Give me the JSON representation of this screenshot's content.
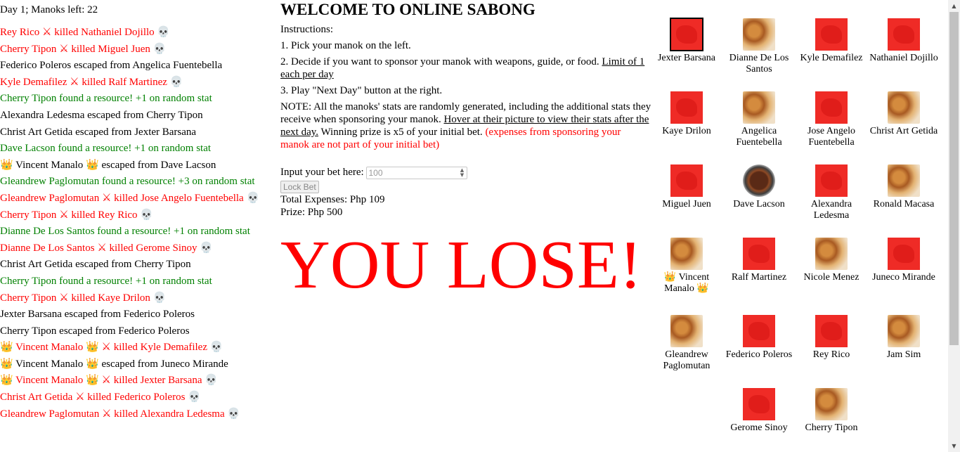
{
  "status": "Day 1; Manoks left: 22",
  "log": [
    {
      "type": "kill",
      "pre": "",
      "a": "Rey Rico",
      "a_suffix": "",
      "mid": " ⚔ killed ",
      "b": "Nathaniel Dojillo",
      "end": " 💀"
    },
    {
      "type": "kill",
      "pre": "",
      "a": "Cherry Tipon",
      "a_suffix": "",
      "mid": " ⚔ killed ",
      "b": "Miguel Juen",
      "end": " 💀"
    },
    {
      "type": "esc",
      "text": "Federico Poleros escaped from Angelica Fuentebella"
    },
    {
      "type": "kill",
      "pre": "",
      "a": "Kyle Demafilez",
      "a_suffix": "",
      "mid": " ⚔ killed ",
      "b": "Ralf Martinez",
      "end": " 💀"
    },
    {
      "type": "res",
      "text": "Cherry Tipon found a resource! +1 on random stat"
    },
    {
      "type": "esc",
      "text": "Alexandra Ledesma escaped from Cherry Tipon"
    },
    {
      "type": "esc",
      "text": "Christ Art Getida escaped from Jexter Barsana"
    },
    {
      "type": "res",
      "text": "Dave Lacson found a resource! +1 on random stat"
    },
    {
      "type": "esc",
      "text": "👑 Vincent Manalo 👑 escaped from Dave Lacson"
    },
    {
      "type": "res",
      "text": "Gleandrew Paglomutan found a resource! +3 on random stat"
    },
    {
      "type": "kill",
      "pre": "",
      "a": "Gleandrew Paglomutan",
      "a_suffix": "",
      "mid": " ⚔ killed ",
      "b": "Jose Angelo Fuentebella",
      "end": " 💀"
    },
    {
      "type": "kill",
      "pre": "",
      "a": "Cherry Tipon",
      "a_suffix": "",
      "mid": " ⚔ killed ",
      "b": "Rey Rico",
      "end": " 💀"
    },
    {
      "type": "res",
      "text": "Dianne De Los Santos found a resource! +1 on random stat"
    },
    {
      "type": "kill",
      "pre": "",
      "a": "Dianne De Los Santos",
      "a_suffix": "",
      "mid": " ⚔ killed ",
      "b": "Gerome Sinoy",
      "end": " 💀"
    },
    {
      "type": "esc",
      "text": "Christ Art Getida escaped from Cherry Tipon"
    },
    {
      "type": "res",
      "text": "Cherry Tipon found a resource! +1 on random stat"
    },
    {
      "type": "kill",
      "pre": "",
      "a": "Cherry Tipon",
      "a_suffix": "",
      "mid": " ⚔ killed ",
      "b": "Kaye Drilon",
      "end": " 💀"
    },
    {
      "type": "esc",
      "text": "Jexter Barsana escaped from Federico Poleros"
    },
    {
      "type": "esc",
      "text": "Cherry Tipon escaped from Federico Poleros"
    },
    {
      "type": "kill",
      "pre": "👑 ",
      "a": "Vincent Manalo",
      "a_suffix": " 👑",
      "mid": " ⚔ killed ",
      "b": "Kyle Demafilez",
      "end": " 💀"
    },
    {
      "type": "esc",
      "text": "👑 Vincent Manalo 👑 escaped from Juneco Mirande"
    },
    {
      "type": "kill",
      "pre": "👑 ",
      "a": "Vincent Manalo",
      "a_suffix": " 👑",
      "mid": " ⚔ killed ",
      "b": "Jexter Barsana",
      "end": " 💀"
    },
    {
      "type": "kill",
      "pre": "",
      "a": "Christ Art Getida",
      "a_suffix": "",
      "mid": " ⚔ killed ",
      "b": "Federico Poleros",
      "end": " 💀"
    },
    {
      "type": "kill",
      "pre": "",
      "a": "Gleandrew Paglomutan",
      "a_suffix": "",
      "mid": " ⚔ killed ",
      "b": "Alexandra Ledesma",
      "end": " 💀"
    }
  ],
  "main": {
    "title": "WELCOME TO ONLINE SABONG",
    "instructions_label": "Instructions:",
    "step1": "1. Pick your manok on the left.",
    "step2_text": "2. Decide if you want to sponsor your manok with weapons, guide, or food. ",
    "step2_underline": "Limit of 1 each per day",
    "step3": "3. Play \"Next Day\" button at the right.",
    "note_text": "NOTE: All the manoks' stats are randomly generated, including the additional stats they receive when sponsoring your manok. ",
    "note_underline": "Hover at their picture to view their stats after the next day.",
    "note_text2": " Winning prize is x5 of your initial bet. ",
    "note_red": "(expenses from sponsoring your manok are not part of your initial bet)",
    "bet_label": "Input your bet here: ",
    "bet_placeholder": "100",
    "lock_label": "Lock Bet",
    "expenses": "Total Expenses: Php 109",
    "prize": "Prize: Php 500",
    "result": "YOU LOSE!"
  },
  "manoks": [
    {
      "name": "Jexter Barsana",
      "img": "red",
      "selected": true
    },
    {
      "name": "Dianne De Los Santos",
      "img": "food"
    },
    {
      "name": "Kyle Demafilez",
      "img": "red"
    },
    {
      "name": "Nathaniel Dojillo",
      "img": "red"
    },
    {
      "name": "Kaye Drilon",
      "img": "red"
    },
    {
      "name": "Angelica Fuentebella",
      "img": "food"
    },
    {
      "name": "Jose Angelo Fuentebella",
      "img": "red"
    },
    {
      "name": "Christ Art Getida",
      "img": "food"
    },
    {
      "name": "Miguel Juen",
      "img": "red"
    },
    {
      "name": "Dave Lacson",
      "img": "bowl"
    },
    {
      "name": "Alexandra Ledesma",
      "img": "red"
    },
    {
      "name": "Ronald Macasa",
      "img": "food"
    },
    {
      "name": "👑 Vincent Manalo 👑",
      "img": "food"
    },
    {
      "name": "Ralf Martinez",
      "img": "red"
    },
    {
      "name": "Nicole Menez",
      "img": "food"
    },
    {
      "name": "Juneco Mirande",
      "img": "red"
    },
    {
      "name": "Gleandrew Paglomutan",
      "img": "food"
    },
    {
      "name": "Federico Poleros",
      "img": "red"
    },
    {
      "name": "Rey Rico",
      "img": "red"
    },
    {
      "name": "Jam Sim",
      "img": "food"
    },
    {
      "name": "Gerome Sinoy",
      "img": "red"
    },
    {
      "name": "Cherry Tipon",
      "img": "food"
    }
  ],
  "colors": {
    "kill": "#ff0000",
    "resource": "#008000",
    "lose": "#ff0000"
  }
}
